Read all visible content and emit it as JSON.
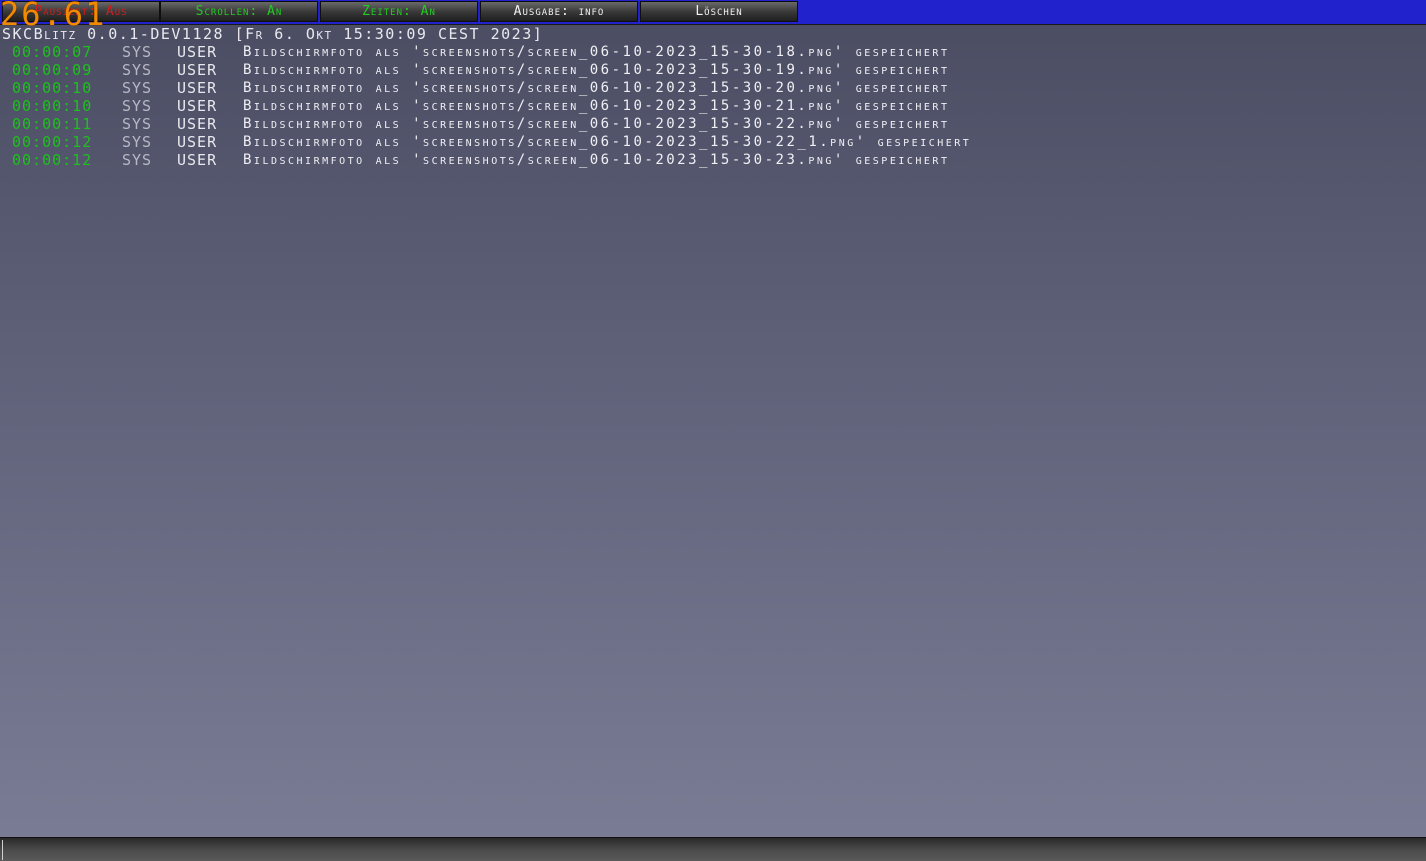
{
  "fps": "26.61",
  "toolbar": {
    "buttons": [
      {
        "label": "Pausiert: Aus",
        "color": "#cc2020"
      },
      {
        "label": "Scrollen: An",
        "color": "#22cc22"
      },
      {
        "label": "Zeiten: An",
        "color": "#22cc22"
      },
      {
        "label": "Ausgabe: info",
        "color": "#f0f0f0"
      },
      {
        "label": "Löschen",
        "color": "#f0f0f0"
      }
    ]
  },
  "version": "SKCBlitz 0.0.1-DEV1128 [Fr 6. Okt 15:30:09 CEST 2023]",
  "log": [
    {
      "time": "00:00:07",
      "source": "SYS",
      "level": "USER",
      "message": "Bildschirmfoto als 'screenshots/screen_06-10-2023_15-30-18.png' gespeichert"
    },
    {
      "time": "00:00:09",
      "source": "SYS",
      "level": "USER",
      "message": "Bildschirmfoto als 'screenshots/screen_06-10-2023_15-30-19.png' gespeichert"
    },
    {
      "time": "00:00:10",
      "source": "SYS",
      "level": "USER",
      "message": "Bildschirmfoto als 'screenshots/screen_06-10-2023_15-30-20.png' gespeichert"
    },
    {
      "time": "00:00:10",
      "source": "SYS",
      "level": "USER",
      "message": "Bildschirmfoto als 'screenshots/screen_06-10-2023_15-30-21.png' gespeichert"
    },
    {
      "time": "00:00:11",
      "source": "SYS",
      "level": "USER",
      "message": "Bildschirmfoto als 'screenshots/screen_06-10-2023_15-30-22.png' gespeichert"
    },
    {
      "time": "00:00:12",
      "source": "SYS",
      "level": "USER",
      "message": "Bildschirmfoto als 'screenshots/screen_06-10-2023_15-30-22_1.png' gespeichert"
    },
    {
      "time": "00:00:12",
      "source": "SYS",
      "level": "USER",
      "message": "Bildschirmfoto als 'screenshots/screen_06-10-2023_15-30-23.png' gespeichert"
    }
  ],
  "input": {
    "value": "",
    "placeholder": ""
  },
  "colors": {
    "toolbar_bg": "#2222cc",
    "fps": "#f08a00",
    "time": "#1fbf1f"
  }
}
